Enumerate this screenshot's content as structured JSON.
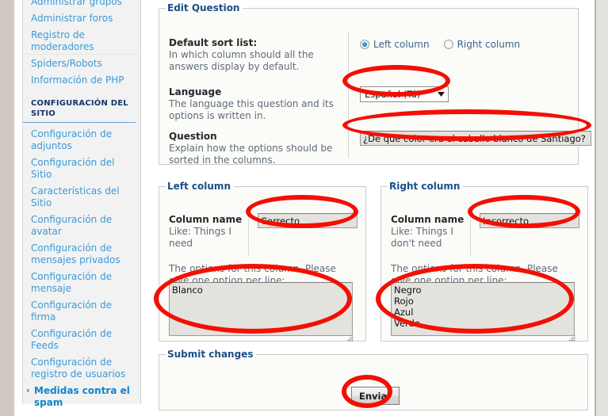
{
  "sidebar": {
    "items_top": [
      {
        "label": "Administrar grupos",
        "active": false
      },
      {
        "label": "Administrar foros",
        "active": false
      },
      {
        "label": "Registro de moderadores",
        "active": false
      },
      {
        "label": "Spiders/Robots",
        "active": false
      },
      {
        "label": "Información de PHP",
        "active": false
      }
    ],
    "section_heading": "CONFIGURACIÓN DEL SITIO",
    "items_bottom": [
      {
        "label": "Configuración de adjuntos",
        "active": false
      },
      {
        "label": "Configuración del Sitio",
        "active": false
      },
      {
        "label": "Características del Sitio",
        "active": false
      },
      {
        "label": "Configuración de avatar",
        "active": false
      },
      {
        "label": "Configuración de mensajes privados",
        "active": false
      },
      {
        "label": "Configuración de mensaje",
        "active": false
      },
      {
        "label": "Configuración de firma",
        "active": false
      },
      {
        "label": "Configuración de Feeds",
        "active": false
      },
      {
        "label": "Configuración de registro de usuarios",
        "active": false
      },
      {
        "label": "Medidas contra el spam",
        "active": true
      }
    ]
  },
  "edit_question": {
    "legend": "Edit Question",
    "sort": {
      "label": "Default sort list:",
      "desc": "In which column should all the answers display by default.",
      "options": [
        {
          "label": "Left column",
          "selected": true
        },
        {
          "label": "Right column",
          "selected": false
        }
      ]
    },
    "language": {
      "label": "Language",
      "desc": "The language this question and its options is written in.",
      "selected": "Español (Tú)"
    },
    "question": {
      "label": "Question",
      "desc": "Explain how the options should be sorted in the columns.",
      "value": "¿De qué color era el caballo blanco de Santiago?"
    }
  },
  "left_column": {
    "legend": "Left column",
    "name_label": "Column name",
    "name_desc": "Like: Things I need",
    "name_value": "Correcto",
    "options_hint": "The options for this column. Please give one option per line:",
    "options_value": "Blanco"
  },
  "right_column": {
    "legend": "Right column",
    "name_label": "Column name",
    "name_desc": "Like: Things I don't need",
    "name_value": "Incorrecto",
    "options_hint": "The options for this column. Please give one option per line:",
    "options_value": "Negro\nRojo\nAzul\nVerde"
  },
  "submit": {
    "legend": "Submit changes",
    "button_label": "Enviar"
  },
  "colors": {
    "annotation": "#f30f04",
    "link": "#3c9ad6",
    "legend": "#1c4f86",
    "heading": "#16356b"
  }
}
